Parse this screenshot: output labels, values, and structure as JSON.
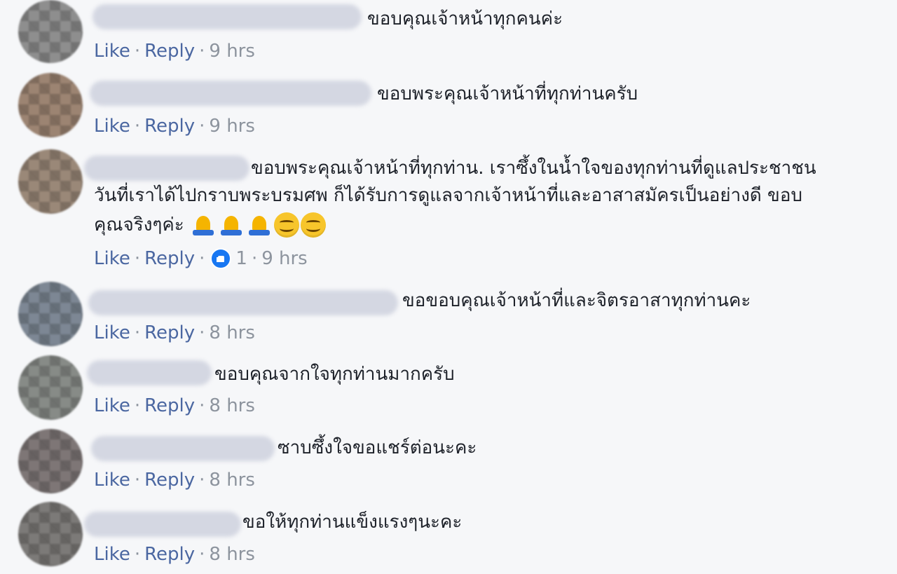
{
  "comments": [
    {
      "text": "ขอบคุณเจ้าหน้าทุกคนค่ะ",
      "actions": {
        "like": "Like",
        "reply": "Reply",
        "time": "9 hrs"
      }
    },
    {
      "text": "ขอบพระคุณเจ้าหน้าที่ทุกท่านครับ",
      "actions": {
        "like": "Like",
        "reply": "Reply",
        "time": "9 hrs"
      }
    },
    {
      "text_line1": "ขอบพระคุณเจ้าหน้าที่ทุกท่าน. เราซึ้งในน้ำใจของทุกท่านที่ดูแลประชาชน",
      "text_line2": "วันที่เราได้ไปกราบพระบรมศพ ก็ได้รับการดูแลจากเจ้าหน้าที่และอาสาสมัครเป็นอย่างดี ขอบ",
      "text_line3": "คุณจริงๆค่ะ",
      "emojis": [
        "folded-hands-icon",
        "folded-hands-icon",
        "folded-hands-icon",
        "smiling-face-icon",
        "smiling-face-icon"
      ],
      "actions": {
        "like": "Like",
        "reply": "Reply",
        "like_count": "1",
        "time": "9 hrs"
      }
    },
    {
      "text": "ขอขอบคุณเจ้าหน้าที่และจิตรอาสาทุกท่านคะ",
      "actions": {
        "like": "Like",
        "reply": "Reply",
        "time": "8 hrs"
      }
    },
    {
      "text": "ขอบคุณจากใจทุกท่านมากครับ",
      "actions": {
        "like": "Like",
        "reply": "Reply",
        "time": "8 hrs"
      }
    },
    {
      "text": "ซาบซึ้งใจขอแชร์ต่อนะคะ",
      "actions": {
        "like": "Like",
        "reply": "Reply",
        "time": "8 hrs"
      }
    },
    {
      "text": "ขอให้ทุกท่านแข็งแรงๆนะคะ",
      "actions": {
        "like": "Like",
        "reply": "Reply",
        "time": "8 hrs"
      }
    }
  ],
  "separator": "·",
  "colors": {
    "background": "#f6f7f9",
    "text": "#1d2129",
    "link": "#4b67a1",
    "meta": "#8d949e",
    "like_badge": "#1877f2"
  }
}
